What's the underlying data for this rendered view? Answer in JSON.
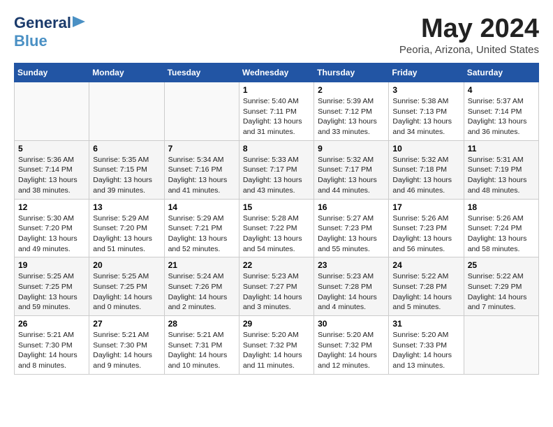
{
  "logo": {
    "general": "General",
    "blue": "Blue"
  },
  "title": "May 2024",
  "subtitle": "Peoria, Arizona, United States",
  "weekdays": [
    "Sunday",
    "Monday",
    "Tuesday",
    "Wednesday",
    "Thursday",
    "Friday",
    "Saturday"
  ],
  "weeks": [
    [
      {
        "day": "",
        "info": ""
      },
      {
        "day": "",
        "info": ""
      },
      {
        "day": "",
        "info": ""
      },
      {
        "day": "1",
        "info": "Sunrise: 5:40 AM\nSunset: 7:11 PM\nDaylight: 13 hours\nand 31 minutes."
      },
      {
        "day": "2",
        "info": "Sunrise: 5:39 AM\nSunset: 7:12 PM\nDaylight: 13 hours\nand 33 minutes."
      },
      {
        "day": "3",
        "info": "Sunrise: 5:38 AM\nSunset: 7:13 PM\nDaylight: 13 hours\nand 34 minutes."
      },
      {
        "day": "4",
        "info": "Sunrise: 5:37 AM\nSunset: 7:14 PM\nDaylight: 13 hours\nand 36 minutes."
      }
    ],
    [
      {
        "day": "5",
        "info": "Sunrise: 5:36 AM\nSunset: 7:14 PM\nDaylight: 13 hours\nand 38 minutes."
      },
      {
        "day": "6",
        "info": "Sunrise: 5:35 AM\nSunset: 7:15 PM\nDaylight: 13 hours\nand 39 minutes."
      },
      {
        "day": "7",
        "info": "Sunrise: 5:34 AM\nSunset: 7:16 PM\nDaylight: 13 hours\nand 41 minutes."
      },
      {
        "day": "8",
        "info": "Sunrise: 5:33 AM\nSunset: 7:17 PM\nDaylight: 13 hours\nand 43 minutes."
      },
      {
        "day": "9",
        "info": "Sunrise: 5:32 AM\nSunset: 7:17 PM\nDaylight: 13 hours\nand 44 minutes."
      },
      {
        "day": "10",
        "info": "Sunrise: 5:32 AM\nSunset: 7:18 PM\nDaylight: 13 hours\nand 46 minutes."
      },
      {
        "day": "11",
        "info": "Sunrise: 5:31 AM\nSunset: 7:19 PM\nDaylight: 13 hours\nand 48 minutes."
      }
    ],
    [
      {
        "day": "12",
        "info": "Sunrise: 5:30 AM\nSunset: 7:20 PM\nDaylight: 13 hours\nand 49 minutes."
      },
      {
        "day": "13",
        "info": "Sunrise: 5:29 AM\nSunset: 7:20 PM\nDaylight: 13 hours\nand 51 minutes."
      },
      {
        "day": "14",
        "info": "Sunrise: 5:29 AM\nSunset: 7:21 PM\nDaylight: 13 hours\nand 52 minutes."
      },
      {
        "day": "15",
        "info": "Sunrise: 5:28 AM\nSunset: 7:22 PM\nDaylight: 13 hours\nand 54 minutes."
      },
      {
        "day": "16",
        "info": "Sunrise: 5:27 AM\nSunset: 7:23 PM\nDaylight: 13 hours\nand 55 minutes."
      },
      {
        "day": "17",
        "info": "Sunrise: 5:26 AM\nSunset: 7:23 PM\nDaylight: 13 hours\nand 56 minutes."
      },
      {
        "day": "18",
        "info": "Sunrise: 5:26 AM\nSunset: 7:24 PM\nDaylight: 13 hours\nand 58 minutes."
      }
    ],
    [
      {
        "day": "19",
        "info": "Sunrise: 5:25 AM\nSunset: 7:25 PM\nDaylight: 13 hours\nand 59 minutes."
      },
      {
        "day": "20",
        "info": "Sunrise: 5:25 AM\nSunset: 7:25 PM\nDaylight: 14 hours\nand 0 minutes."
      },
      {
        "day": "21",
        "info": "Sunrise: 5:24 AM\nSunset: 7:26 PM\nDaylight: 14 hours\nand 2 minutes."
      },
      {
        "day": "22",
        "info": "Sunrise: 5:23 AM\nSunset: 7:27 PM\nDaylight: 14 hours\nand 3 minutes."
      },
      {
        "day": "23",
        "info": "Sunrise: 5:23 AM\nSunset: 7:28 PM\nDaylight: 14 hours\nand 4 minutes."
      },
      {
        "day": "24",
        "info": "Sunrise: 5:22 AM\nSunset: 7:28 PM\nDaylight: 14 hours\nand 5 minutes."
      },
      {
        "day": "25",
        "info": "Sunrise: 5:22 AM\nSunset: 7:29 PM\nDaylight: 14 hours\nand 7 minutes."
      }
    ],
    [
      {
        "day": "26",
        "info": "Sunrise: 5:21 AM\nSunset: 7:30 PM\nDaylight: 14 hours\nand 8 minutes."
      },
      {
        "day": "27",
        "info": "Sunrise: 5:21 AM\nSunset: 7:30 PM\nDaylight: 14 hours\nand 9 minutes."
      },
      {
        "day": "28",
        "info": "Sunrise: 5:21 AM\nSunset: 7:31 PM\nDaylight: 14 hours\nand 10 minutes."
      },
      {
        "day": "29",
        "info": "Sunrise: 5:20 AM\nSunset: 7:32 PM\nDaylight: 14 hours\nand 11 minutes."
      },
      {
        "day": "30",
        "info": "Sunrise: 5:20 AM\nSunset: 7:32 PM\nDaylight: 14 hours\nand 12 minutes."
      },
      {
        "day": "31",
        "info": "Sunrise: 5:20 AM\nSunset: 7:33 PM\nDaylight: 14 hours\nand 13 minutes."
      },
      {
        "day": "",
        "info": ""
      }
    ]
  ]
}
